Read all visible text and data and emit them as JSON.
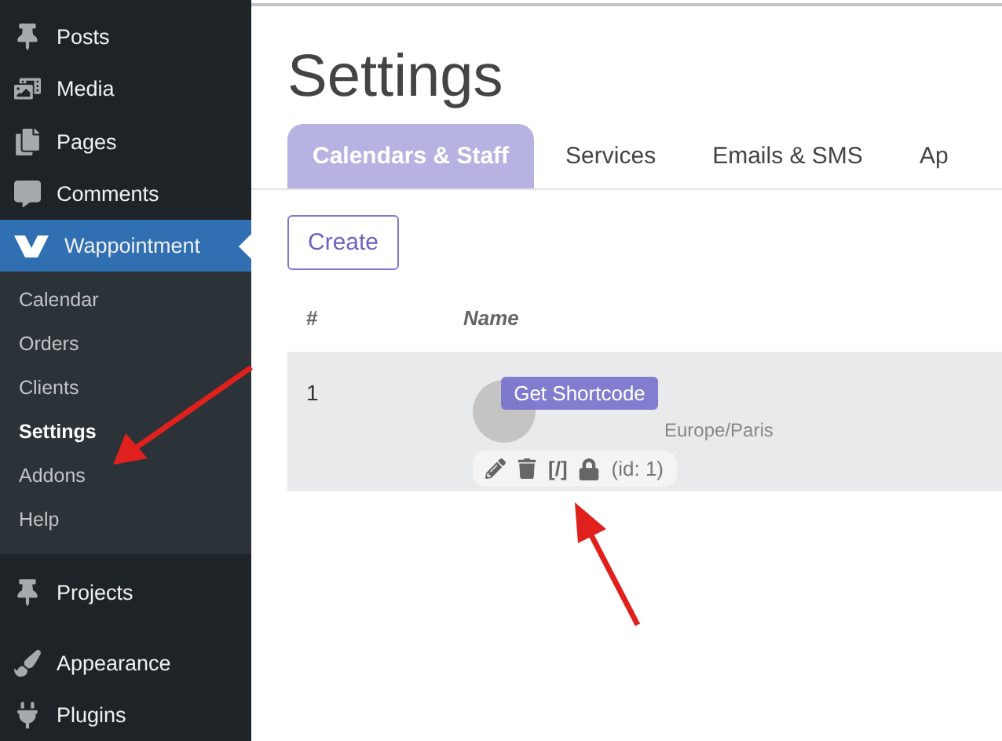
{
  "sidebar": {
    "items": [
      {
        "label": "Posts",
        "selected": false
      },
      {
        "label": "Media",
        "selected": false
      },
      {
        "label": "Pages",
        "selected": false
      },
      {
        "label": "Comments",
        "selected": false
      },
      {
        "label": "Wappointment",
        "selected": true,
        "children": [
          {
            "label": "Calendar",
            "selected": false
          },
          {
            "label": "Orders",
            "selected": false
          },
          {
            "label": "Clients",
            "selected": false
          },
          {
            "label": "Settings",
            "selected": true
          },
          {
            "label": "Addons",
            "selected": false
          },
          {
            "label": "Help",
            "selected": false
          }
        ]
      },
      {
        "label": "Projects",
        "selected": false
      },
      {
        "label": "Appearance",
        "selected": false
      },
      {
        "label": "Plugins",
        "selected": false
      }
    ]
  },
  "page": {
    "title": "Settings",
    "tabs": [
      {
        "label": "Calendars & Staff",
        "selected": true
      },
      {
        "label": "Services",
        "selected": false
      },
      {
        "label": "Emails & SMS",
        "selected": false
      },
      {
        "label": "Ap",
        "selected": false
      }
    ],
    "create_button": "Create",
    "table": {
      "columns": [
        "#",
        "Name"
      ],
      "rows": [
        {
          "number": "1",
          "timezone": "Europe/Paris",
          "shortcode_label": "[/]",
          "id_label": "(id: 1)",
          "tooltip": "Get Shortcode"
        }
      ]
    }
  }
}
